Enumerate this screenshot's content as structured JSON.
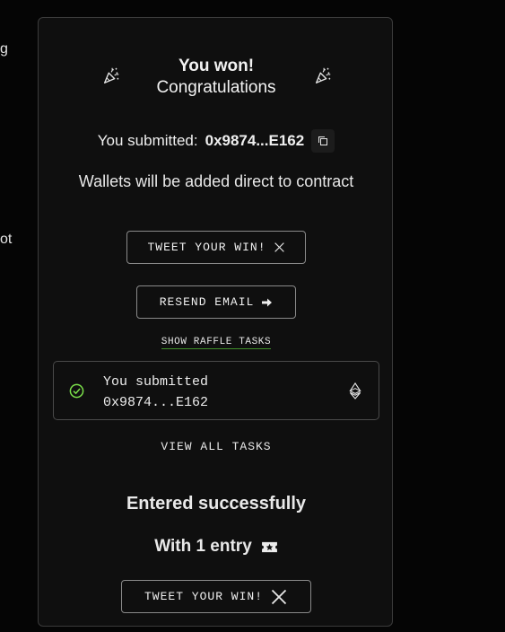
{
  "background_fragments": {
    "top": "g",
    "middle": "ot"
  },
  "result": {
    "title_line1": "You won!",
    "title_line2": "Congratulations",
    "submitted_label": "You submitted:",
    "submitted_address": "0x9874...E162",
    "wallet_note": "Wallets will be added direct to contract"
  },
  "buttons": {
    "tweet_label": "TWEET YOUR WIN!",
    "resend_label": "RESEND EMAIL",
    "raffle_tasks_label": "SHOW RAFFLE TASKS",
    "view_all_label": "VIEW ALL TASKS",
    "tweet_bottom_label": "TWEET YOUR WIN!"
  },
  "task": {
    "line1": "You submitted",
    "line2": "0x9874...E162",
    "status": "completed"
  },
  "entry": {
    "entered_text": "Entered successfully",
    "entry_text": "With 1 entry"
  },
  "colors": {
    "success": "#7be04a",
    "panel_bg": "#0f0f0f",
    "page_bg": "#050505",
    "border": "#3b3b3b"
  },
  "icons": [
    "party-popper-icon",
    "copy-icon",
    "x-logo-icon",
    "arrow-right-icon",
    "check-circle-icon",
    "ethereum-icon",
    "ticket-icon"
  ]
}
